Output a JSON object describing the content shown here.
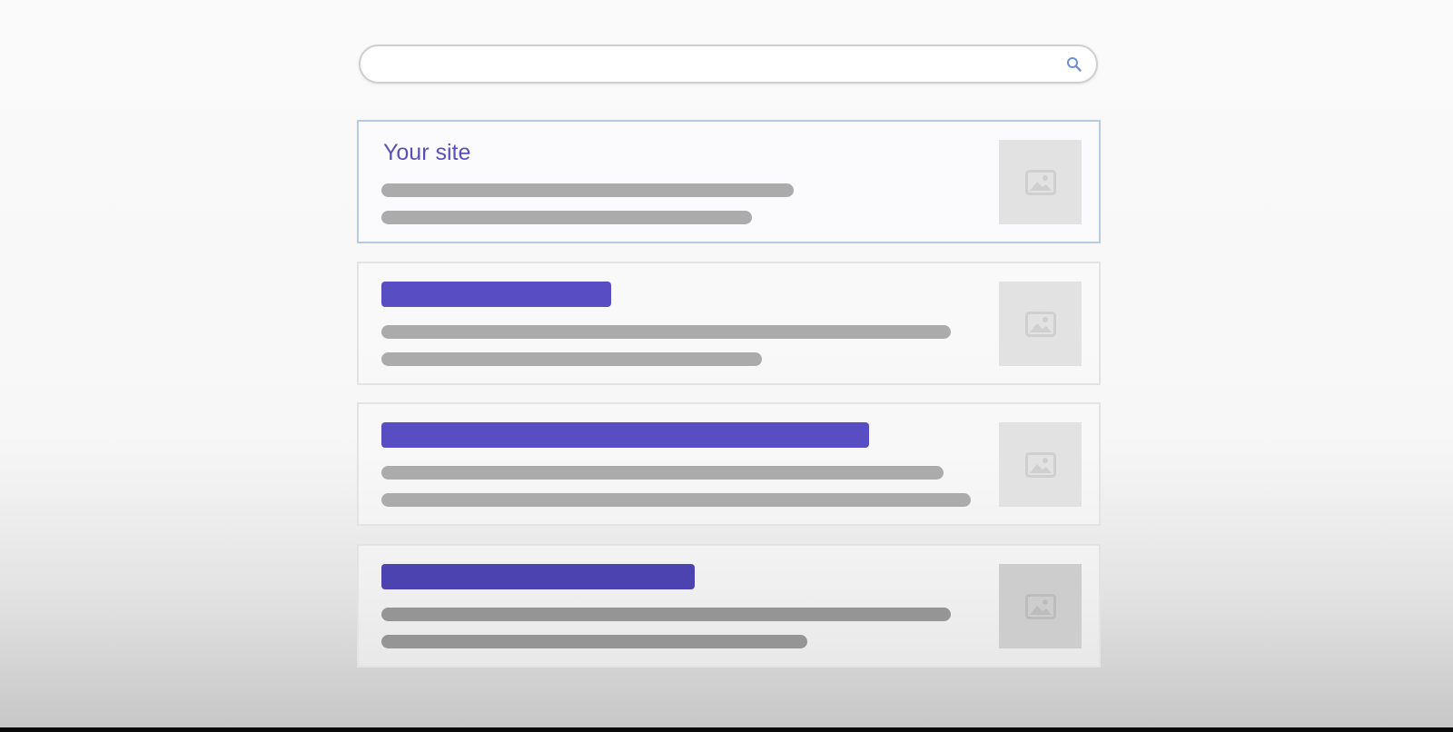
{
  "search": {
    "value": "",
    "placeholder": "",
    "icon": "search-icon"
  },
  "results": [
    {
      "title": "Your site",
      "kind": "highlighted"
    },
    {
      "title": "",
      "kind": "placeholder"
    },
    {
      "title": "",
      "kind": "placeholder"
    },
    {
      "title": "",
      "kind": "placeholder"
    }
  ],
  "colors": {
    "accent_title": "#5b50b9",
    "title_bar": "#584dc2",
    "text_line": "#ababab",
    "image_placeholder": "#e2e2e2",
    "highlight_border": "#b9c8e4"
  }
}
